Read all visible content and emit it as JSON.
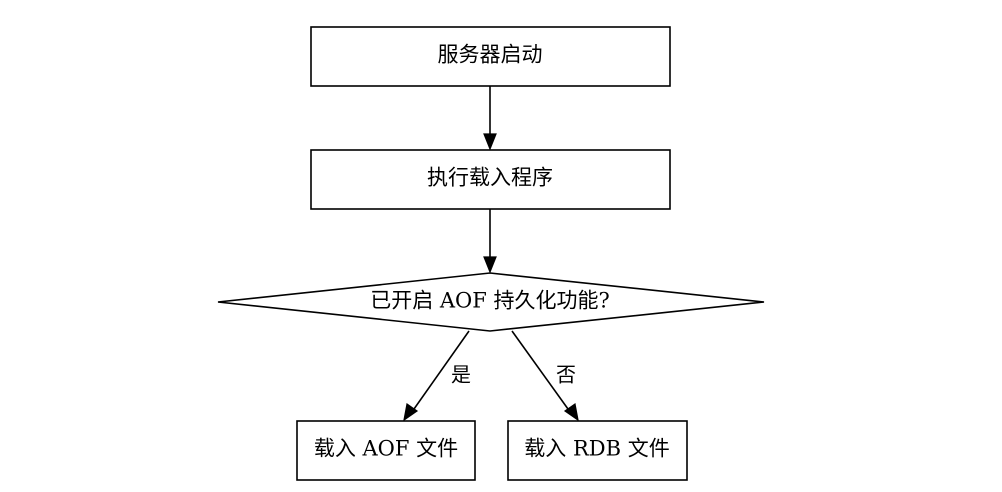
{
  "diagram": {
    "nodes": {
      "server_start": "服务器启动",
      "run_loader": "执行载入程序",
      "aof_enabled": "已开启 AOF 持久化功能?",
      "load_aof": "载入 AOF 文件",
      "load_rdb": "载入 RDB 文件"
    },
    "edges": {
      "yes": "是",
      "no": "否"
    }
  }
}
